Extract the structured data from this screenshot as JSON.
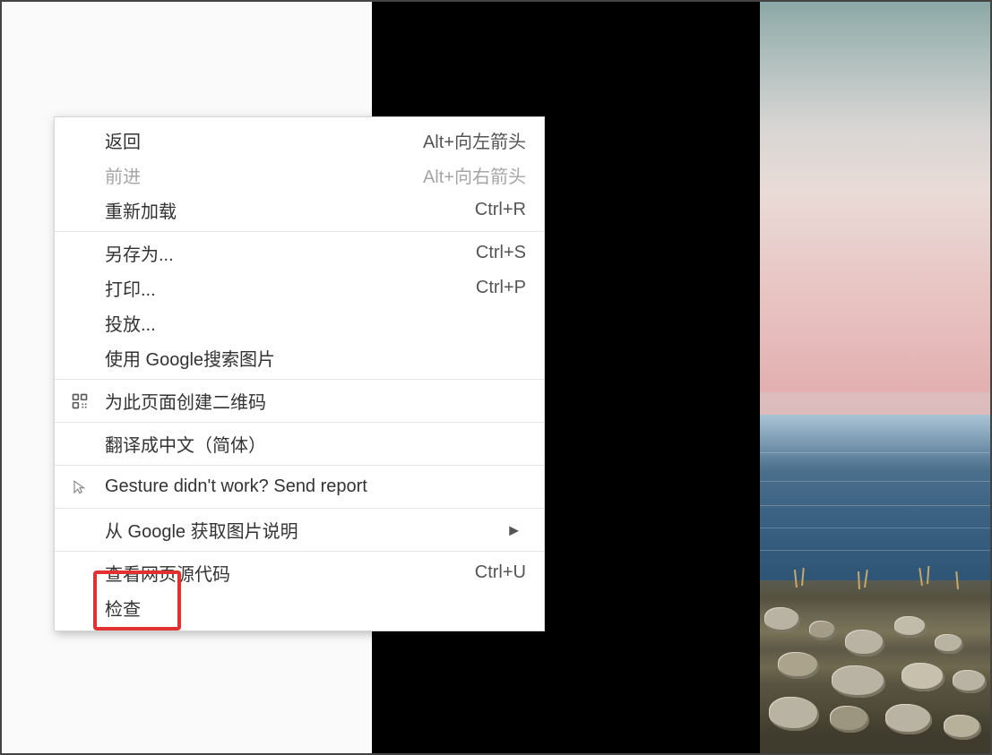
{
  "context_menu": {
    "items": [
      {
        "label": "返回",
        "shortcut": "Alt+向左箭头",
        "disabled": false,
        "icon": null,
        "submenu": false
      },
      {
        "label": "前进",
        "shortcut": "Alt+向右箭头",
        "disabled": true,
        "icon": null,
        "submenu": false
      },
      {
        "label": "重新加载",
        "shortcut": "Ctrl+R",
        "disabled": false,
        "icon": null,
        "submenu": false
      },
      {
        "sep": true
      },
      {
        "label": "另存为...",
        "shortcut": "Ctrl+S",
        "disabled": false,
        "icon": null,
        "submenu": false
      },
      {
        "label": "打印...",
        "shortcut": "Ctrl+P",
        "disabled": false,
        "icon": null,
        "submenu": false
      },
      {
        "label": "投放...",
        "shortcut": "",
        "disabled": false,
        "icon": null,
        "submenu": false
      },
      {
        "label": "使用 Google搜索图片",
        "shortcut": "",
        "disabled": false,
        "icon": null,
        "submenu": false
      },
      {
        "sep": true
      },
      {
        "label": "为此页面创建二维码",
        "shortcut": "",
        "disabled": false,
        "icon": "qr",
        "submenu": false
      },
      {
        "sep": true
      },
      {
        "label": "翻译成中文（简体）",
        "shortcut": "",
        "disabled": false,
        "icon": null,
        "submenu": false
      },
      {
        "sep": true
      },
      {
        "label": "Gesture didn't work? Send report",
        "shortcut": "",
        "disabled": false,
        "icon": "cursor",
        "submenu": false
      },
      {
        "sep": true
      },
      {
        "label": "从 Google 获取图片说明",
        "shortcut": "",
        "disabled": false,
        "icon": null,
        "submenu": true
      },
      {
        "sep": true
      },
      {
        "label": "查看网页源代码",
        "shortcut": "Ctrl+U",
        "disabled": false,
        "icon": null,
        "submenu": false
      },
      {
        "label": "检查",
        "shortcut": "",
        "disabled": false,
        "icon": null,
        "submenu": false,
        "highlighted": true
      }
    ]
  }
}
